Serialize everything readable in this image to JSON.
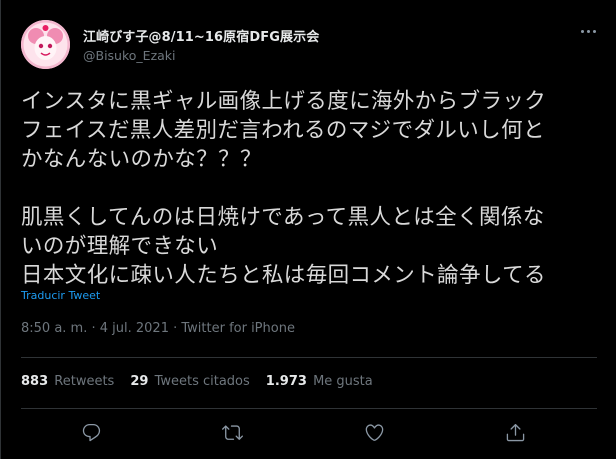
{
  "user": {
    "display_name": "江崎びす子@8/11~16原宿DFG展示会",
    "handle": "@Bisuko_Ezaki",
    "avatar_icon": "avatar-image"
  },
  "tweet": {
    "text": "インスタに黒ギャル画像上げる度に海外からブラック\nフェイスだ黒人差別だ言われるのマジでダルいし何と\nかなんないのかな？？？\n\n肌黒くしてんのは日焼けであって黒人とは全く関係な\nいのが理解できない\n日本文化に疎い人たちと私は毎回コメント論争してる",
    "translate_label": "Traducir Tweet",
    "timestamp": "8:50 a. m. · 4 jul. 2021 · Twitter for iPhone"
  },
  "stats": {
    "retweets_count": "883",
    "retweets_label": "Retweets",
    "quotes_count": "29",
    "quotes_label": "Tweets citados",
    "likes_count": "1.973",
    "likes_label": "Me gusta"
  },
  "actions": {
    "reply_icon": "reply-icon",
    "retweet_icon": "retweet-icon",
    "like_icon": "heart-icon",
    "share_icon": "share-icon"
  },
  "colors": {
    "background": "#000000",
    "link": "#1d9bf0",
    "muted": "#6e767d"
  }
}
